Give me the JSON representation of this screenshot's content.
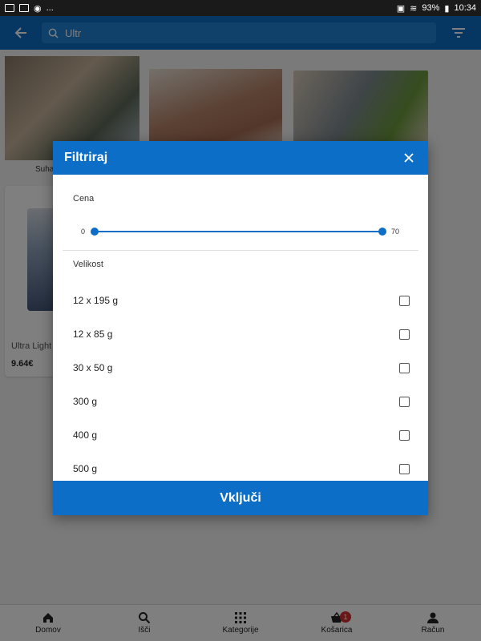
{
  "status_bar": {
    "battery": "93%",
    "time": "10:34",
    "dots": "..."
  },
  "app_bar": {
    "search_value": "Ultr"
  },
  "products": {
    "category_label": "Suha",
    "card": {
      "name": "Ultra Light V",
      "price": "9.64€"
    }
  },
  "dialog": {
    "title": "Filtriraj",
    "price_section": "Cena",
    "price_min": "0",
    "price_max": "70",
    "size_section": "Velikost",
    "options": [
      {
        "label": "12 x 195 g",
        "checked": false
      },
      {
        "label": "12 x 85 g",
        "checked": false
      },
      {
        "label": "30 x 50 g",
        "checked": false
      },
      {
        "label": "300 g",
        "checked": false
      },
      {
        "label": "400 g",
        "checked": false
      },
      {
        "label": "500 g",
        "checked": false
      }
    ],
    "apply_label": "Vključi"
  },
  "bottom_nav": {
    "items": [
      {
        "label": "Domov",
        "icon": "home-icon"
      },
      {
        "label": "Išči",
        "icon": "search-icon"
      },
      {
        "label": "Kategorije",
        "icon": "grid-icon"
      },
      {
        "label": "Košarica",
        "icon": "basket-icon",
        "badge": "1"
      },
      {
        "label": "Račun",
        "icon": "person-icon"
      }
    ]
  },
  "colors": {
    "primary": "#0d6ec7",
    "badge": "#d32f2f"
  }
}
